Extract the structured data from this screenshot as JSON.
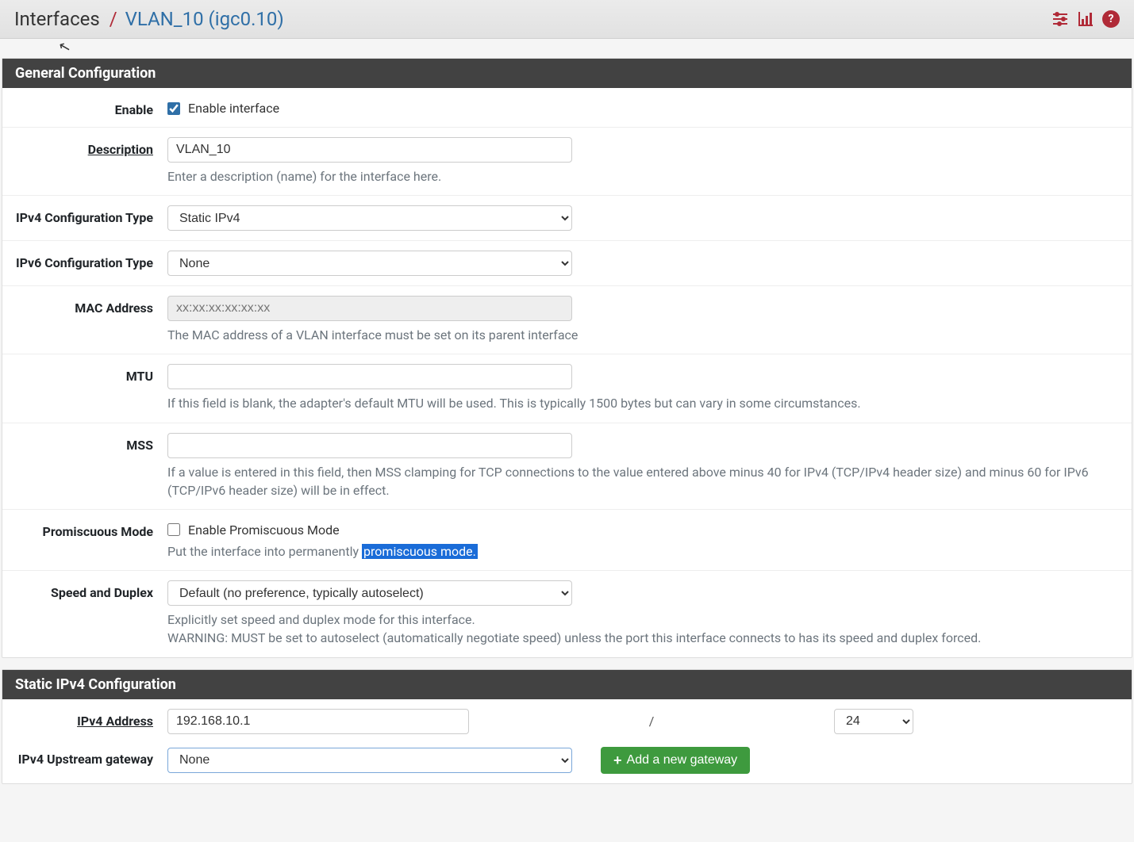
{
  "header": {
    "crumb_root": "Interfaces",
    "crumb_sep": "/",
    "crumb_leaf": "VLAN_10 (igc0.10)"
  },
  "panels": {
    "general": {
      "title": "General Configuration",
      "enable": {
        "label": "Enable",
        "checkbox_label": "Enable interface",
        "checked": true
      },
      "description": {
        "label": "Description",
        "value": "VLAN_10",
        "help": "Enter a description (name) for the interface here."
      },
      "ipv4_type": {
        "label": "IPv4 Configuration Type",
        "value": "Static IPv4"
      },
      "ipv6_type": {
        "label": "IPv6 Configuration Type",
        "value": "None"
      },
      "mac": {
        "label": "MAC Address",
        "placeholder": "xx:xx:xx:xx:xx:xx",
        "help": "The MAC address of a VLAN interface must be set on its parent interface"
      },
      "mtu": {
        "label": "MTU",
        "value": "",
        "help": "If this field is blank, the adapter's default MTU will be used. This is typically 1500 bytes but can vary in some circumstances."
      },
      "mss": {
        "label": "MSS",
        "value": "",
        "help": "If a value is entered in this field, then MSS clamping for TCP connections to the value entered above minus 40 for IPv4 (TCP/IPv4 header size) and minus 60 for IPv6 (TCP/IPv6 header size) will be in effect."
      },
      "promiscuous": {
        "label": "Promiscuous Mode",
        "checkbox_label": "Enable Promiscuous Mode",
        "checked": false,
        "help_pre": "Put the interface into permanently ",
        "help_link": "promiscuous mode."
      },
      "speed": {
        "label": "Speed and Duplex",
        "value": "Default (no preference, typically autoselect)",
        "help1": "Explicitly set speed and duplex mode for this interface.",
        "help2": "WARNING: MUST be set to autoselect (automatically negotiate speed) unless the port this interface connects to has its speed and duplex forced."
      }
    },
    "static_ipv4": {
      "title": "Static IPv4 Configuration",
      "address": {
        "label": "IPv4 Address",
        "value": "192.168.10.1",
        "mask_sep": "/",
        "mask": "24"
      },
      "gateway": {
        "label": "IPv4 Upstream gateway",
        "value": "None",
        "add_button": "Add a new gateway"
      }
    }
  }
}
